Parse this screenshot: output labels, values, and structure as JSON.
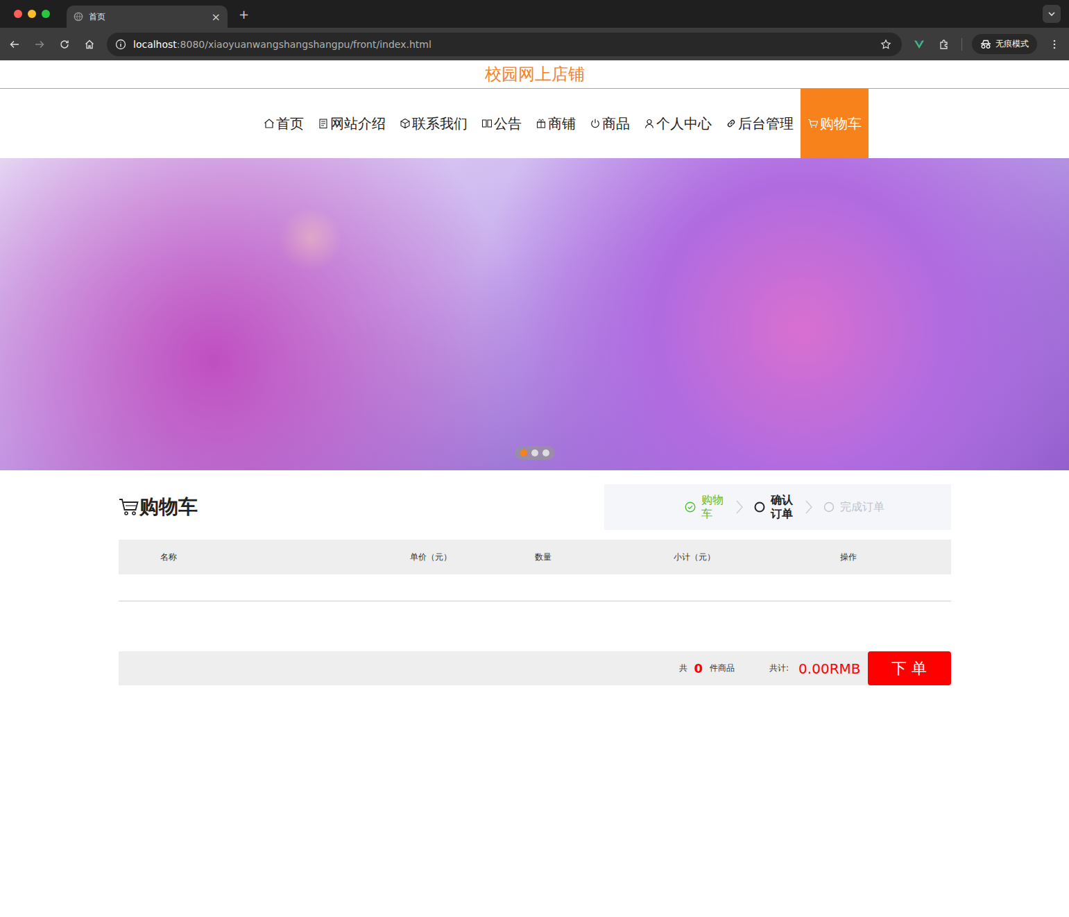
{
  "window": {
    "title": "首页",
    "url_host": "localhost",
    "url_path": ":8080/xiaoyuanwangshangshangpu/front/index.html",
    "incognito": "无痕模式",
    "close": "×",
    "new_tab": "+"
  },
  "site_title": "校园网上店铺",
  "nav": [
    {
      "label": "首页",
      "selected": false
    },
    {
      "label": "网站介绍",
      "selected": false
    },
    {
      "label": "联系我们",
      "selected": false
    },
    {
      "label": "公告",
      "selected": false
    },
    {
      "label": "商铺",
      "selected": false
    },
    {
      "label": "商品",
      "selected": false
    },
    {
      "label": "个人中心",
      "selected": false
    },
    {
      "label": "后台管理",
      "selected": false
    },
    {
      "label": "购物车",
      "selected": true
    }
  ],
  "banner": {
    "slides": [
      {
        "selected": true
      },
      {
        "selected": false
      },
      {
        "selected": false
      }
    ]
  },
  "cart": {
    "title": "购物车",
    "steps": [
      {
        "label": "购物车",
        "status": "done"
      },
      {
        "label": "确认订单",
        "status": "current"
      },
      {
        "label": "完成订单",
        "status": "pending"
      }
    ],
    "columns": [
      "名称",
      "单价（元）",
      "数量",
      "小计（元）",
      "操作"
    ],
    "summary": {
      "count_prefix": "共",
      "count": "0",
      "count_suffix": "件商品",
      "total_label": "共计:",
      "total": "0.00RMB",
      "order_button": "下 单"
    }
  }
}
